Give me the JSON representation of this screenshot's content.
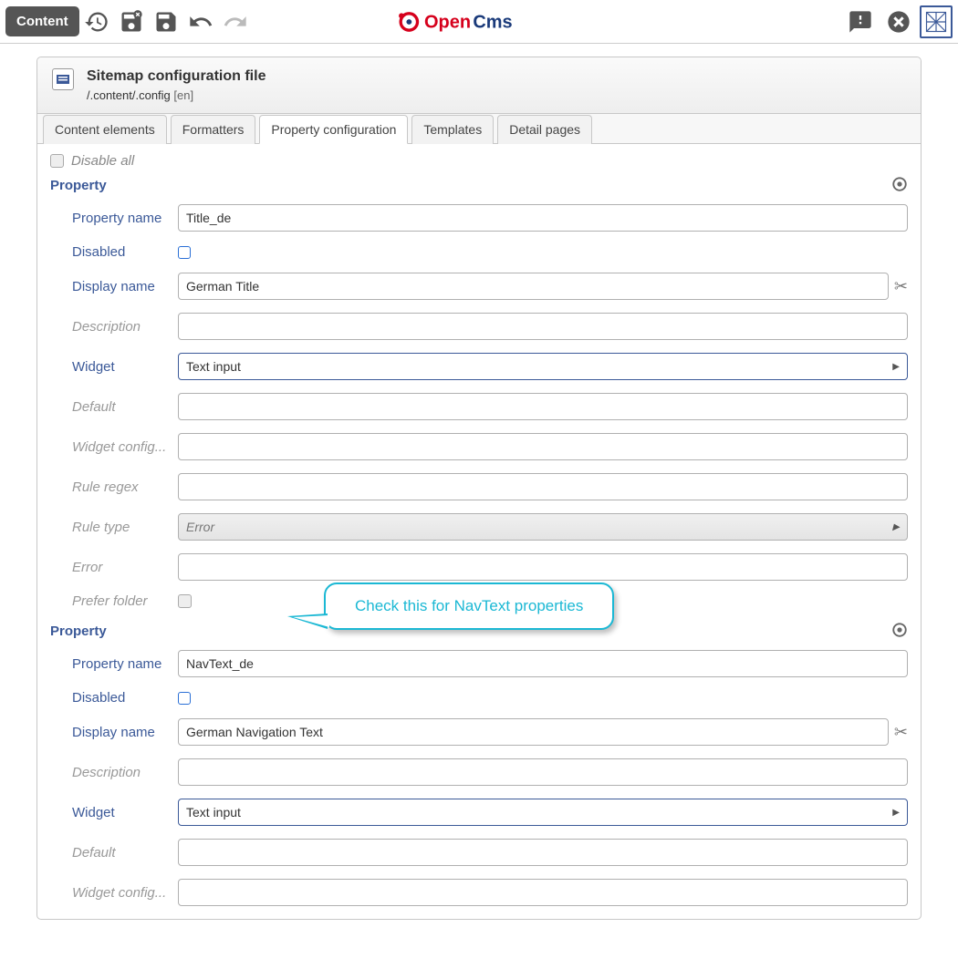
{
  "toolbar": {
    "content_label": "Content"
  },
  "logo": {
    "text1": "Open",
    "text2": "Cms"
  },
  "header": {
    "title": "Sitemap configuration file",
    "path": "/.content/.config",
    "lang": "[en]"
  },
  "tabs": [
    "Content elements",
    "Formatters",
    "Property configuration",
    "Templates",
    "Detail pages"
  ],
  "disable_all_label": "Disable all",
  "group_title": "Property",
  "labels": {
    "property_name": "Property name",
    "disabled": "Disabled",
    "display_name": "Display name",
    "description": "Description",
    "widget": "Widget",
    "default": "Default",
    "widget_config": "Widget config...",
    "rule_regex": "Rule regex",
    "rule_type": "Rule type",
    "error": "Error",
    "prefer_folder": "Prefer folder"
  },
  "widget_option": "Text input",
  "rule_type_option": "Error",
  "tooltip_text": "Check this for NavText properties",
  "prop1": {
    "name": "Title_de",
    "display_name": "German Title"
  },
  "prop2": {
    "name": "NavText_de",
    "display_name": "German Navigation Text"
  }
}
